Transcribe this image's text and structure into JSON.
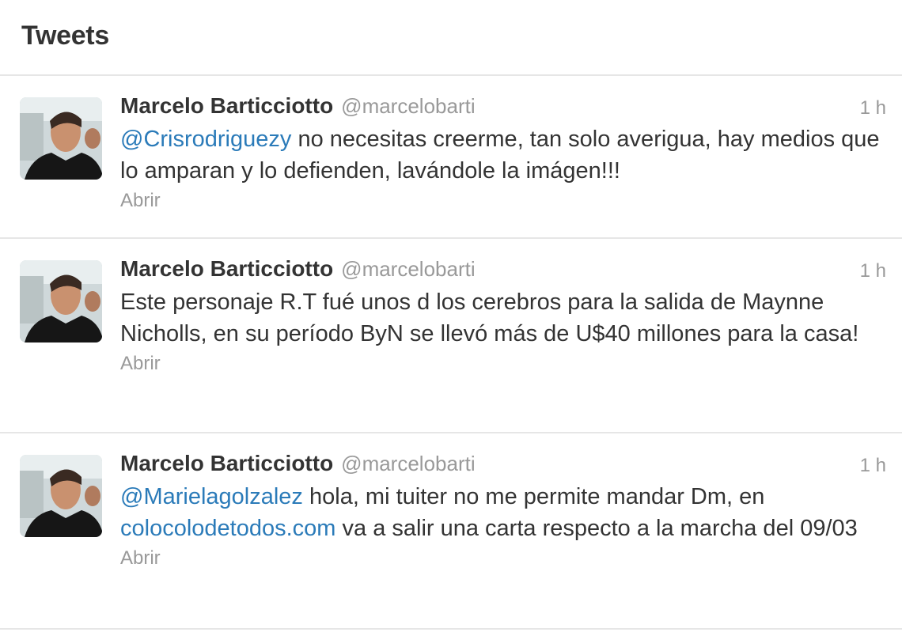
{
  "header": {
    "title": "Tweets"
  },
  "colors": {
    "link": "#2b7bb9",
    "muted": "#999999",
    "text": "#333333",
    "divider": "#e6e6e6"
  },
  "tweets": [
    {
      "name": "Marcelo Barticciotto",
      "handle": "@marcelobarti",
      "time": "1 h",
      "mention": "@Crisrodriguezy",
      "text_a": " no necesitas creerme, tan solo averigua, hay medios que lo amparan y lo defienden, lavándole la imágen!!!",
      "action": "Abrir"
    },
    {
      "name": "Marcelo Barticciotto",
      "handle": "@marcelobarti",
      "time": "1 h",
      "text_a": "Este personaje R.T fué unos d los cerebros para la salida de Maynne Nicholls, en su período ByN se llevó más de U$40 millones para la casa!",
      "action": "Abrir"
    },
    {
      "name": "Marcelo Barticciotto",
      "handle": "@marcelobarti",
      "time": "1 h",
      "mention": "@Marielagolzalez",
      "text_a": " hola, mi tuiter no me permite mandar Dm, en ",
      "url": "colocolodetodos.com",
      "text_b": " va a salir una carta respecto a la marcha del 09/03",
      "action": "Abrir"
    }
  ]
}
